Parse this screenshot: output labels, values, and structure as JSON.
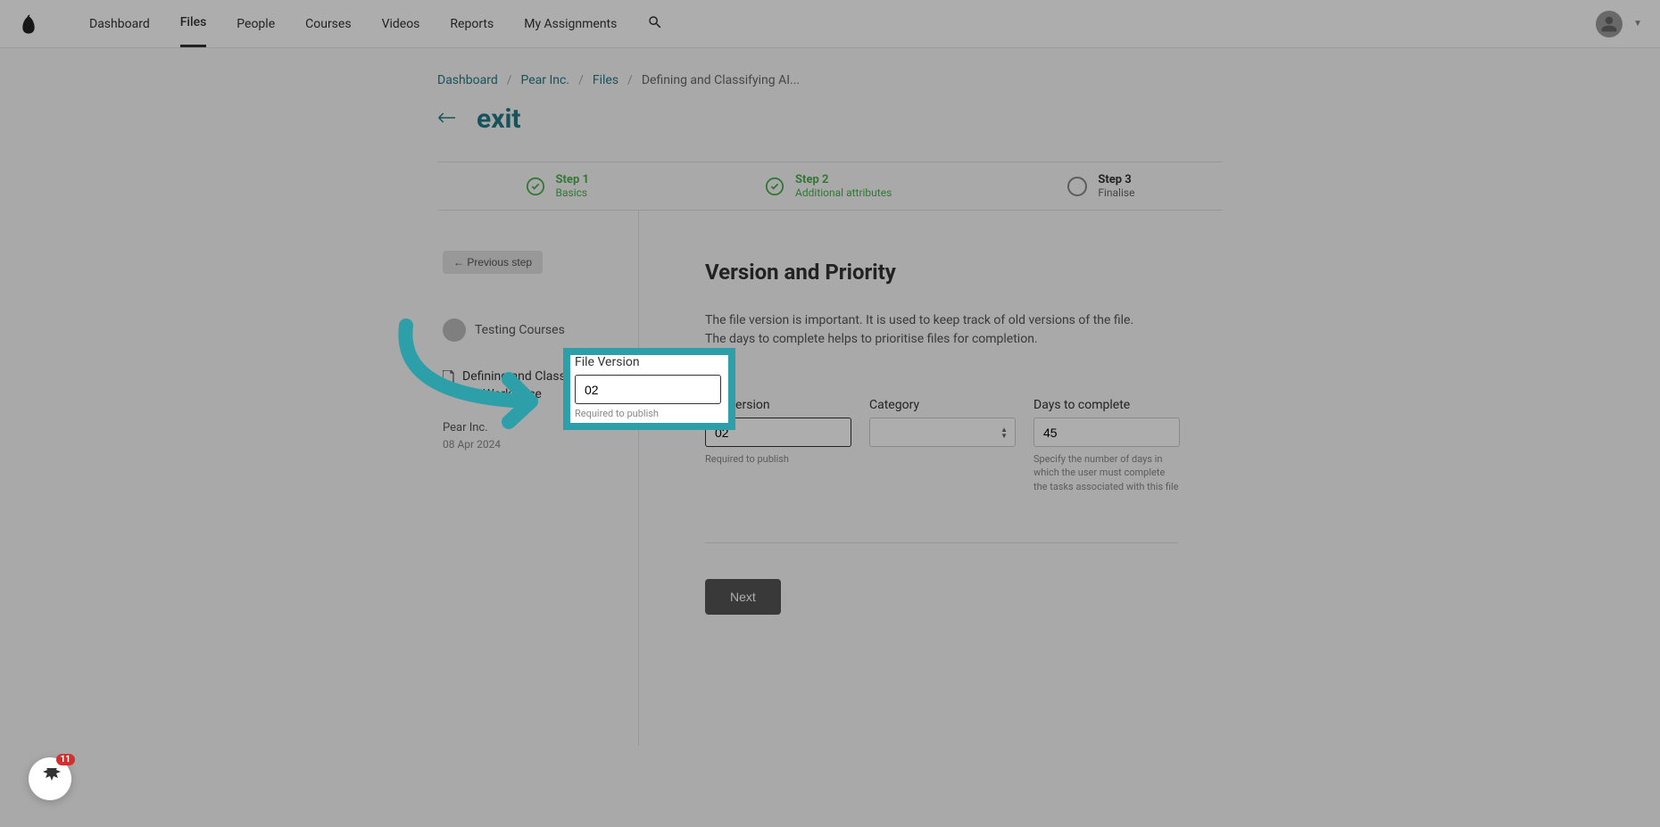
{
  "nav": {
    "items": [
      "Dashboard",
      "Files",
      "People",
      "Courses",
      "Videos",
      "Reports",
      "My Assignments"
    ],
    "active_index": 1
  },
  "breadcrumb": {
    "items": [
      "Dashboard",
      "Pear Inc.",
      "Files",
      "Defining and Classifying AI..."
    ]
  },
  "exit_label": "exit",
  "steps": [
    {
      "label": "Step 1",
      "sub": "Basics",
      "state": "done"
    },
    {
      "label": "Step 2",
      "sub": "Additional attributes",
      "state": "done"
    },
    {
      "label": "Step 3",
      "sub": "Finalise",
      "state": "pending"
    }
  ],
  "left": {
    "prev_button": "← Previous step",
    "user": "Testing Courses",
    "file_title": "Defining and Classifying AI in the Workplace",
    "org": "Pear Inc.",
    "date": "08 Apr 2024"
  },
  "right": {
    "title": "Version and Priority",
    "desc": "The file version is important. It is used to keep track of old versions of the file. The days to complete helps to prioritise files for completion.",
    "version_label": "File Version",
    "version_value": "02",
    "version_hint": "Required to publish",
    "category_label": "Category",
    "days_label": "Days to complete",
    "days_value": "45",
    "days_hint": "Specify the number of days in which the user must complete the tasks associated with this file",
    "next_button": "Next"
  },
  "chat_badge": "11"
}
